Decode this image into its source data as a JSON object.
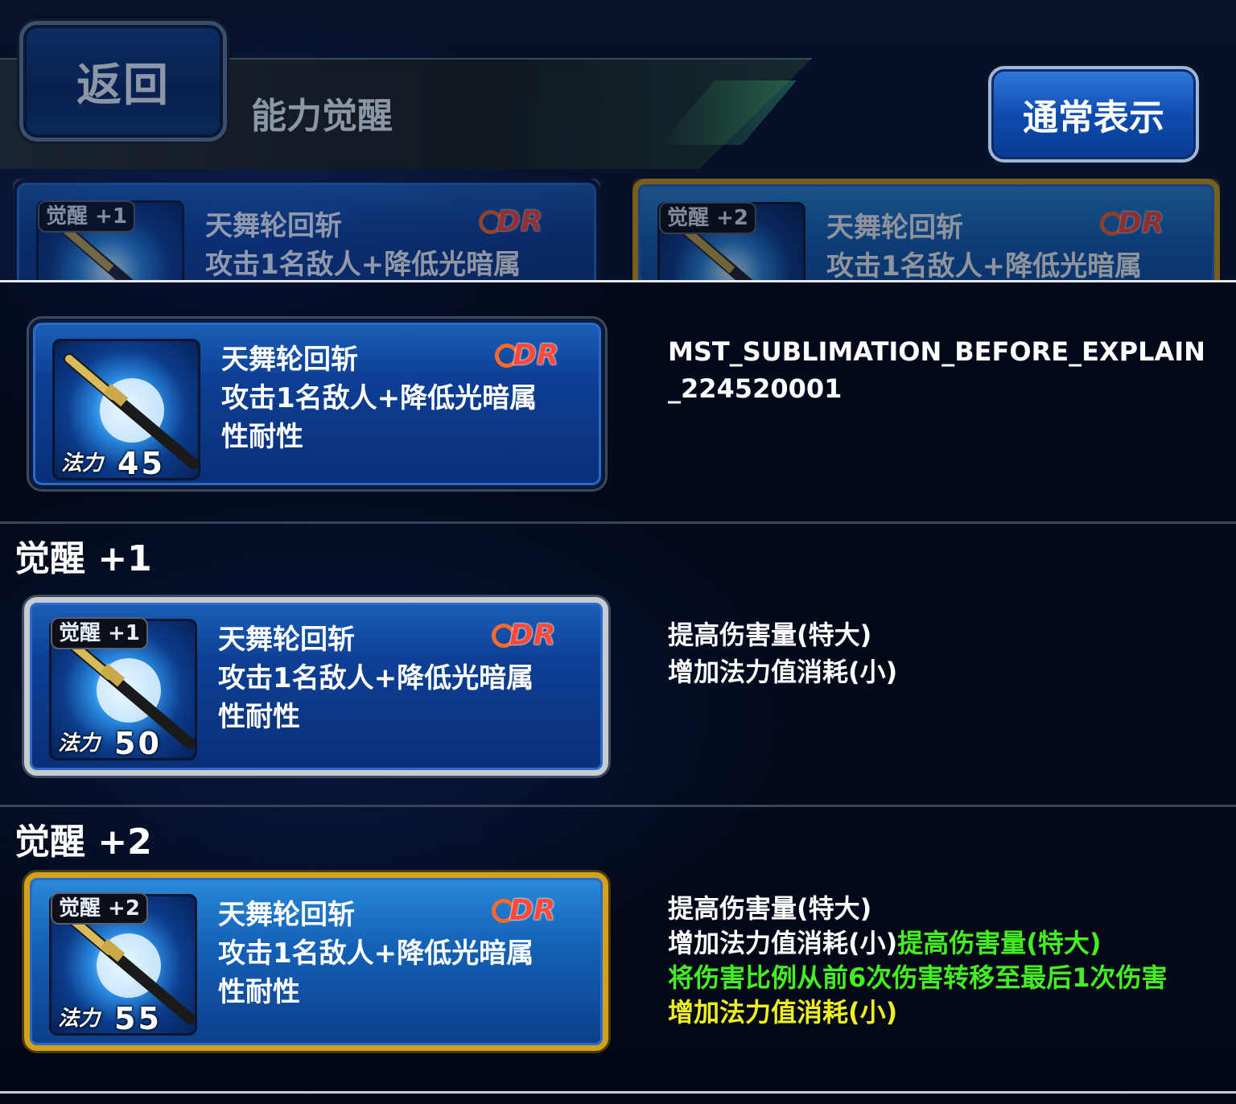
{
  "header": {
    "back_label": "返回",
    "title": "能力觉醒",
    "normal_view_label": "通常表示"
  },
  "preview_cards": [
    {
      "badge": "觉醒 +1",
      "name": "天舞轮回斩",
      "desc": "攻击1名敌人+降低光暗属"
    },
    {
      "badge": "觉醒 +2",
      "name": "天舞轮回斩",
      "desc": "攻击1名敌人+降低光暗属"
    }
  ],
  "base": {
    "name": "天舞轮回斩",
    "desc": "攻击1名敌人+降低光暗属性耐性",
    "mp_label": "法力",
    "mp_value": "45",
    "explain": "MST_SUBLIMATION_BEFORE_EXPLAIN_224520001"
  },
  "awaken1": {
    "section_title": "觉醒 +1",
    "badge": "觉醒 +1",
    "name": "天舞轮回斩",
    "desc": "攻击1名敌人+降低光暗属性耐性",
    "mp_label": "法力",
    "mp_value": "50",
    "explain_lines": [
      "提高伤害量(特大)",
      "增加法力值消耗(小)"
    ]
  },
  "awaken2": {
    "section_title": "觉醒 +2",
    "badge": "觉醒 +2",
    "name": "天舞轮回斩",
    "desc": "攻击1名敌人+降低光暗属性耐性",
    "mp_label": "法力",
    "mp_value": "55",
    "explain_line1": "提高伤害量(特大)",
    "explain_line2_white": "增加法力值消耗(小)",
    "explain_line2_green": "提高伤害量(特大)",
    "explain_line3_green": "将伤害比例从前6次伤害转移至最后1次伤害",
    "explain_line4_yellow": "增加法力值消耗(小)"
  },
  "dr_label": "DR",
  "colors": {
    "green": "#44ee22",
    "yellow": "#eeee22",
    "gold_frame": "#d4a21a",
    "silver_frame": "#c8ccd2"
  }
}
